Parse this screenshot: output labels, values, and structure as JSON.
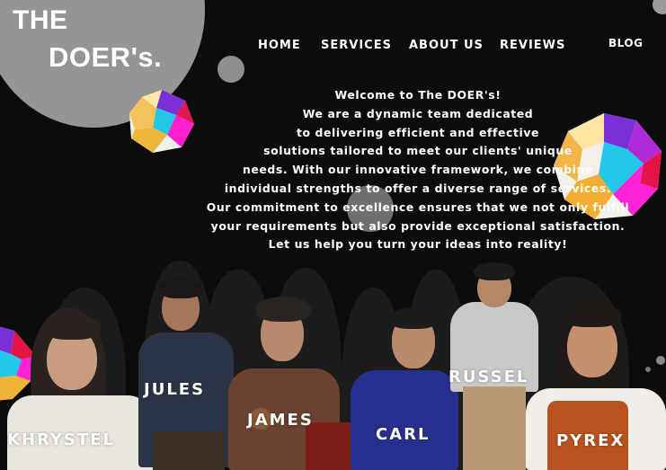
{
  "logo": {
    "line1": "THE",
    "line2": "DOER's."
  },
  "nav": {
    "home": "HOME",
    "services": "SERVICES",
    "about": "ABOUT US",
    "reviews": "REVIEWS",
    "blog": "BLOG"
  },
  "intro": {
    "lines": [
      "Welcome to The DOER's!",
      "We are a dynamic team dedicated",
      "to delivering efficient and effective",
      "solutions tailored to meet our clients' unique",
      "needs. With our innovative framework, we combine",
      "individual strengths to offer a diverse range of services.",
      "Our commitment to excellence ensures that we not only fulfill",
      "your requirements but also provide exceptional satisfaction.",
      "Let us help you turn your ideas into reality!"
    ]
  },
  "team": {
    "khrystel": "KHRYSTEL",
    "jules": "JULES",
    "james": "JAMES",
    "carl": "CARL",
    "russel": "RUSSEL",
    "pyrex": "PYREX"
  },
  "colors": {
    "background": "#0c0c0c",
    "circle": "#959595",
    "text": "#ffffff"
  }
}
